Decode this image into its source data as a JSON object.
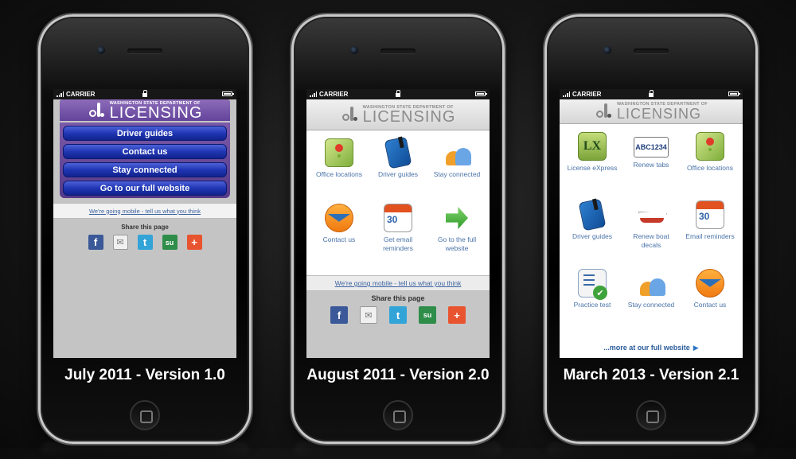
{
  "status": {
    "carrier": "CARRIER"
  },
  "logo": {
    "small": "WASHINGTON STATE DEPARTMENT OF",
    "big": "LICENSING"
  },
  "share": {
    "title": "Share this page",
    "icons": [
      "facebook-icon",
      "email-icon",
      "twitter-icon",
      "stumbleupon-icon",
      "add-plus-icon"
    ]
  },
  "feedback_link": "We're going mobile - tell us what you think",
  "phones": [
    {
      "caption": "July 2011 - Version 1.0",
      "menu": [
        "Driver guides",
        "Contact us",
        "Stay connected",
        "Go to our full website"
      ]
    },
    {
      "caption": "August 2011 - Version 2.0",
      "tiles": [
        {
          "label": "Office locations",
          "icon": "map-pin-icon"
        },
        {
          "label": "Driver guides",
          "icon": "book-icon"
        },
        {
          "label": "Stay connected",
          "icon": "people-icon"
        },
        {
          "label": "Contact us",
          "icon": "mail-icon"
        },
        {
          "label": "Get email reminders",
          "icon": "calendar-icon"
        },
        {
          "label": "Go to the full website",
          "icon": "arrow-right-icon"
        }
      ]
    },
    {
      "caption": "March 2013 - Version 2.1",
      "tiles": [
        {
          "label": "License eXpress",
          "icon": "lx-icon",
          "icon_text": "LX"
        },
        {
          "label": "Renew tabs",
          "icon": "license-plate-icon",
          "icon_text": "ABC1234"
        },
        {
          "label": "Office locations",
          "icon": "map-pin-icon"
        },
        {
          "label": "Driver guides",
          "icon": "book-icon"
        },
        {
          "label": "Renew boat decals",
          "icon": "boat-icon"
        },
        {
          "label": "Email reminders",
          "icon": "calendar-icon"
        },
        {
          "label": "Practice test",
          "icon": "checklist-icon"
        },
        {
          "label": "Stay connected",
          "icon": "people-icon"
        },
        {
          "label": "Contact us",
          "icon": "mail-icon"
        }
      ],
      "more_link": "...more at our full website",
      "more_arrow": "▶"
    }
  ],
  "colors": {
    "v1_purple": "#63449b",
    "v1_button_blue": "#2036b3",
    "link_blue": "#3d63a0"
  }
}
